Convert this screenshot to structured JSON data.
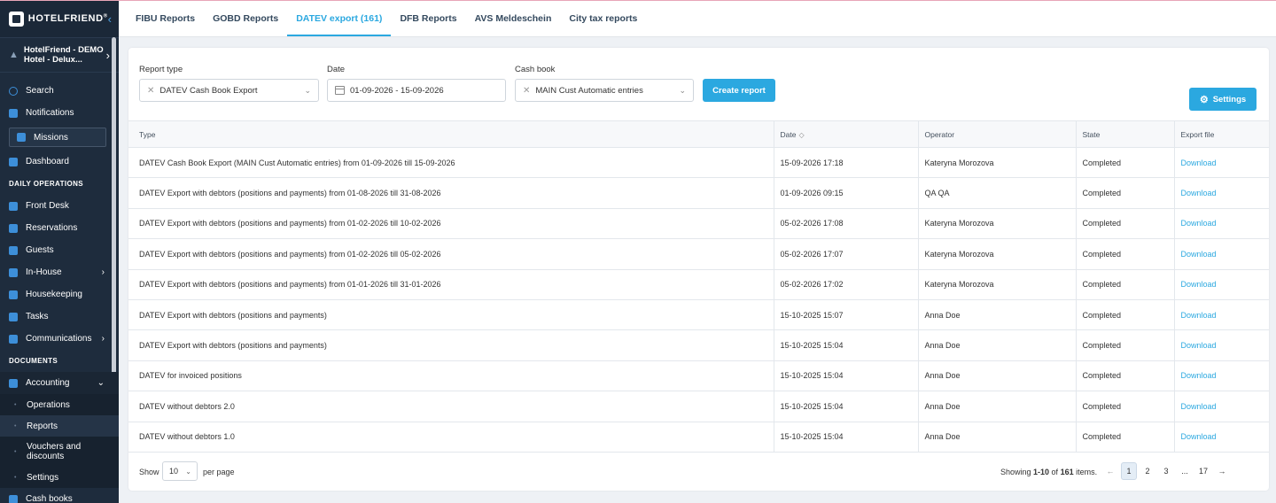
{
  "brand": {
    "name": "HOTELFRIEND",
    "registered": "®"
  },
  "hotel": {
    "name_line1": "HotelFriend - DEMO",
    "name_line2": "Hotel - Delux..."
  },
  "sidebar": {
    "search": "Search",
    "notifications": "Notifications",
    "missions": "Missions",
    "dashboard": "Dashboard",
    "section_daily": "DAILY OPERATIONS",
    "front_desk": "Front Desk",
    "reservations": "Reservations",
    "guests": "Guests",
    "in_house": "In-House",
    "housekeeping": "Housekeeping",
    "tasks": "Tasks",
    "communications": "Communications",
    "section_documents": "DOCUMENTS",
    "accounting": "Accounting",
    "accounting_sub": {
      "operations": "Operations",
      "reports": "Reports",
      "vouchers_line1": "Vouchers and",
      "vouchers_line2": "discounts",
      "settings": "Settings"
    },
    "cash_books": "Cash books"
  },
  "tabs": [
    {
      "label": "FIBU Reports"
    },
    {
      "label": "GOBD Reports"
    },
    {
      "label": "DATEV export (161)"
    },
    {
      "label": "DFB Reports"
    },
    {
      "label": "AVS Meldeschein"
    },
    {
      "label": "City tax reports"
    }
  ],
  "filters": {
    "report_type_label": "Report type",
    "report_type_value": "DATEV Cash Book Export",
    "date_label": "Date",
    "date_value": "01-09-2026 - 15-09-2026",
    "cash_book_label": "Cash book",
    "cash_book_value": "MAIN Cust Automatic entries",
    "create_button": "Create report",
    "settings_button": "Settings"
  },
  "table": {
    "headers": {
      "type": "Type",
      "date": "Date",
      "operator": "Operator",
      "state": "State",
      "export": "Export file"
    },
    "rows": [
      {
        "type": "DATEV Cash Book Export (MAIN Cust Automatic entries) from 01-09-2026 till 15-09-2026",
        "date": "15-09-2026 17:18",
        "operator": "Kateryna Morozova",
        "state": "Completed",
        "export": "Download"
      },
      {
        "type": "DATEV Export with debtors (positions and payments) from 01-08-2026 till 31-08-2026",
        "date": "01-09-2026 09:15",
        "operator": "QA QA",
        "state": "Completed",
        "export": "Download"
      },
      {
        "type": "DATEV Export with debtors (positions and payments) from 01-02-2026 till 10-02-2026",
        "date": "05-02-2026 17:08",
        "operator": "Kateryna Morozova",
        "state": "Completed",
        "export": "Download"
      },
      {
        "type": "DATEV Export with debtors (positions and payments) from 01-02-2026 till 05-02-2026",
        "date": "05-02-2026 17:07",
        "operator": "Kateryna Morozova",
        "state": "Completed",
        "export": "Download"
      },
      {
        "type": "DATEV Export with debtors (positions and payments) from 01-01-2026 till 31-01-2026",
        "date": "05-02-2026 17:02",
        "operator": "Kateryna Morozova",
        "state": "Completed",
        "export": "Download"
      },
      {
        "type": "DATEV Export with debtors (positions and payments)",
        "date": "15-10-2025 15:07",
        "operator": "Anna Doe",
        "state": "Completed",
        "export": "Download"
      },
      {
        "type": "DATEV Export with debtors (positions and payments)",
        "date": "15-10-2025 15:04",
        "operator": "Anna Doe",
        "state": "Completed",
        "export": "Download"
      },
      {
        "type": "DATEV for invoiced positions",
        "date": "15-10-2025 15:04",
        "operator": "Anna Doe",
        "state": "Completed",
        "export": "Download"
      },
      {
        "type": "DATEV without debtors 2.0",
        "date": "15-10-2025 15:04",
        "operator": "Anna Doe",
        "state": "Completed",
        "export": "Download"
      },
      {
        "type": "DATEV without debtors 1.0",
        "date": "15-10-2025 15:04",
        "operator": "Anna Doe",
        "state": "Completed",
        "export": "Download"
      }
    ]
  },
  "footer": {
    "show": "Show",
    "per_page_value": "10",
    "per_page": "per page",
    "showing_prefix": "Showing ",
    "showing_range": "1-10",
    "showing_of": " of ",
    "showing_total": "161",
    "showing_suffix": " items."
  },
  "pagination": {
    "prev": "←",
    "pages": [
      "1",
      "2",
      "3",
      "...",
      "17"
    ],
    "next": "→"
  },
  "colors": {
    "accent": "#2ba8e0",
    "sidebar_bg": "#1e2c3d"
  }
}
